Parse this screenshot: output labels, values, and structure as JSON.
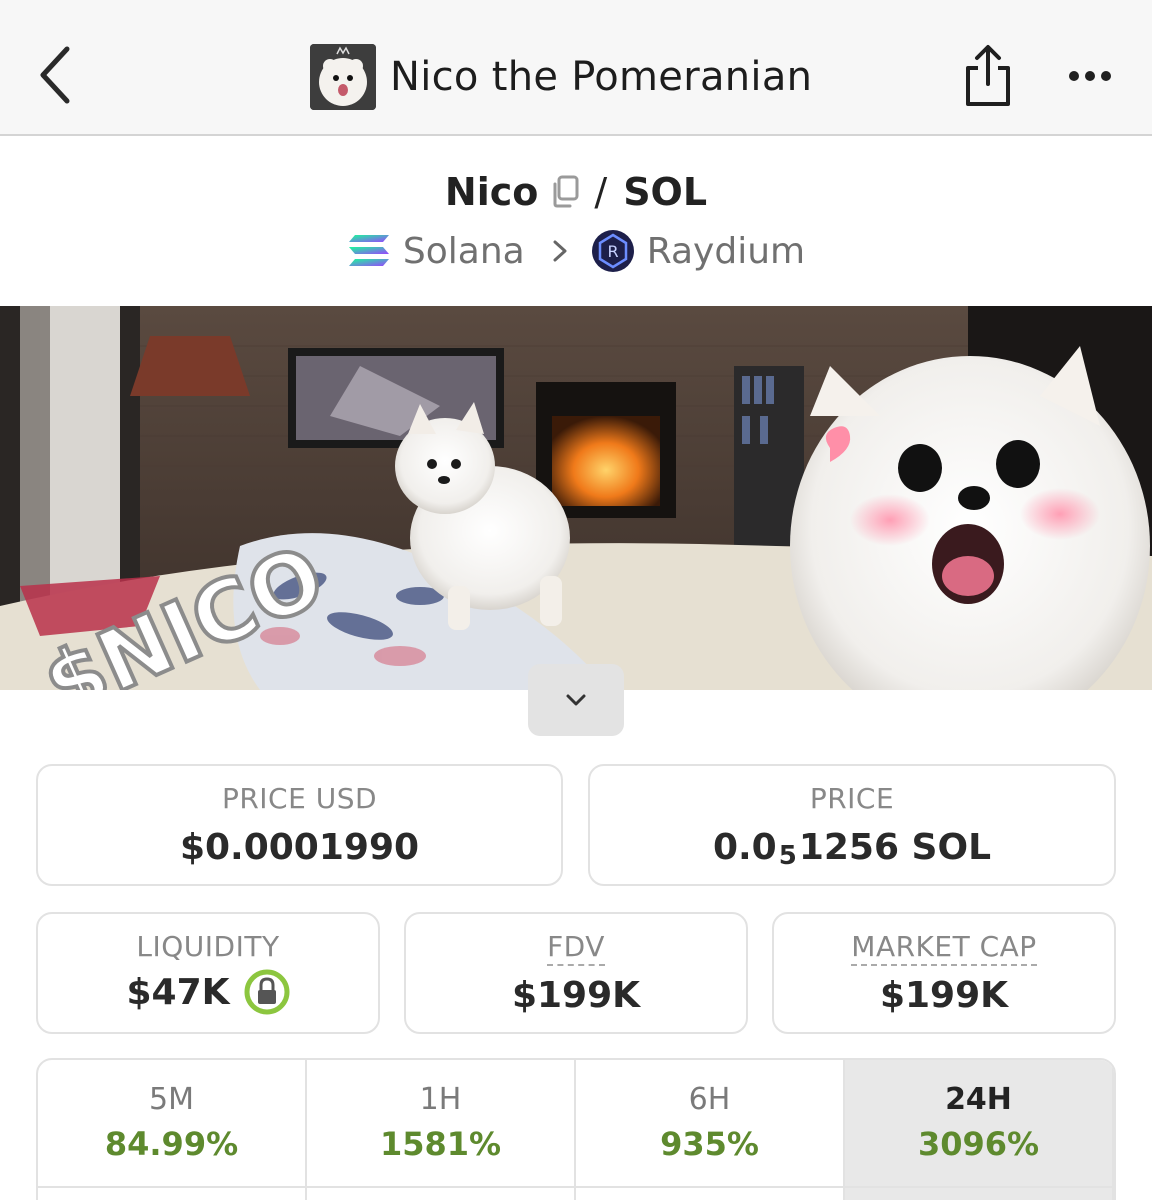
{
  "header": {
    "title": "Nico the Pomeranian",
    "back_icon": "chevron-left-icon",
    "share_icon": "share-icon",
    "more_icon": "more-icon"
  },
  "pair": {
    "base": "Nico",
    "quote": "SOL",
    "separator": "/",
    "chain": "Solana",
    "dex": "Raydium"
  },
  "banner": {
    "text": "$NICO"
  },
  "stats": {
    "price_usd": {
      "label": "PRICE USD",
      "value": "$0.0001990"
    },
    "price": {
      "label": "PRICE",
      "prefix": "0.0",
      "subscript": "5",
      "suffix": "1256 SOL"
    },
    "liquidity": {
      "label": "LIQUIDITY",
      "value": "$47K",
      "locked": true
    },
    "fdv": {
      "label": "FDV",
      "value": "$199K"
    },
    "market_cap": {
      "label": "MARKET CAP",
      "value": "$199K"
    }
  },
  "timeframes": [
    {
      "label": "5M",
      "value": "84.99%",
      "active": false
    },
    {
      "label": "1H",
      "value": "1581%",
      "active": false
    },
    {
      "label": "6H",
      "value": "935%",
      "active": false
    },
    {
      "label": "24H",
      "value": "3096%",
      "active": true
    }
  ],
  "colors": {
    "positive": "#5e8a2e",
    "lock_ring": "#8cc63f",
    "accent_solana": "#9945ff",
    "raydium": "#2b2f6b"
  }
}
